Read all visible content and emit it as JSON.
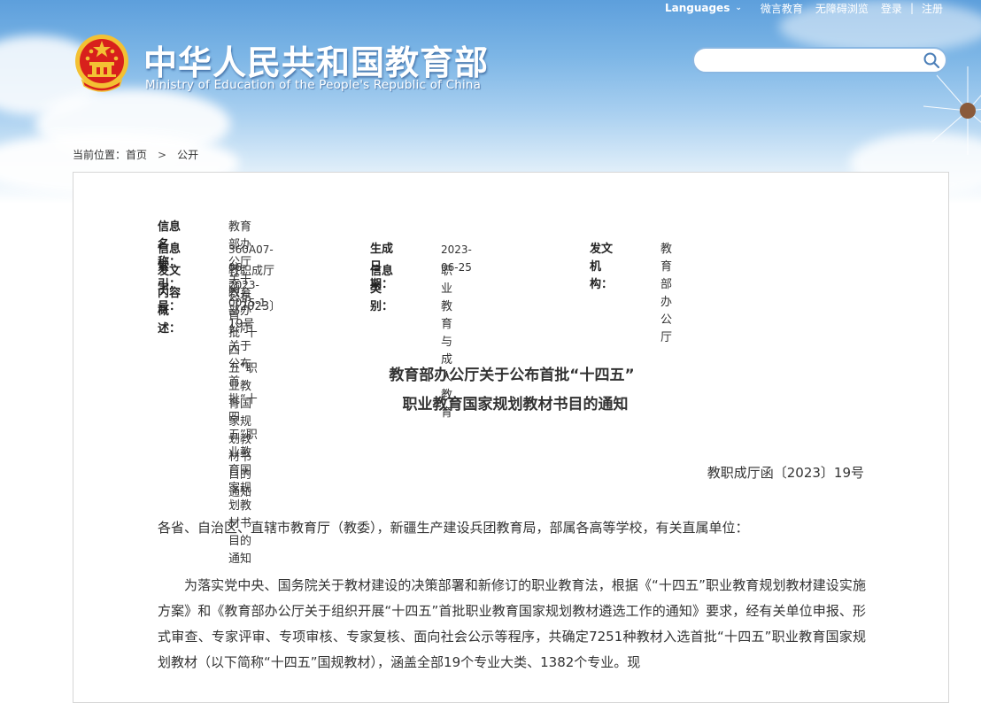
{
  "header": {
    "topbar": {
      "languages": "Languages",
      "weibo": "微言教育",
      "accessibility": "无障碍浏览",
      "login": "登录",
      "separator": "|",
      "register": "注册"
    },
    "title_cn": "中华人民共和国教育部",
    "title_en": "Ministry of Education of the People's Republic of China",
    "search_placeholder": ""
  },
  "breadcrumb": {
    "prefix": "当前位置：",
    "home": "首页",
    "arrow": ">",
    "current": "公开"
  },
  "meta": {
    "name_label": "信息名称：",
    "name_value": "教育部办公厅关于公布首批“十四五”职业教育国家规划教材书目的通知",
    "index_label": "信息索引：",
    "index_value": "360A07-06-2023-0015-1",
    "date_label": "生成日期：",
    "date_value": "2023-06-25",
    "org_label": "发文机构：",
    "org_value": "教育部办公厅",
    "docno_label": "发文字号：",
    "docno_value": "教职成厅函〔2023〕19号",
    "category_label": "信息类别：",
    "category_value": "职业教育与成人教育",
    "summary_label": "内容概述：",
    "summary_value": "教育部办公厅关于公布首批“十四五”职业教育国家规划教材书目的通知"
  },
  "document": {
    "title_line1": "教育部办公厅关于公布首批“十四五”",
    "title_line2": "职业教育国家规划教材书目的通知",
    "doc_number": "教职成厅函〔2023〕19号",
    "salutation": "各省、自治区、直辖市教育厅（教委），新疆生产建设兵团教育局，部属各高等学校，有关直属单位：",
    "paragraph1": "为落实党中央、国务院关于教材建设的决策部署和新修订的职业教育法，根据《“十四五”职业教育规划教材建设实施方案》和《教育部办公厅关于组织开展“十四五”首批职业教育国家规划教材遴选工作的通知》要求，经有关单位申报、形式审查、专家评审、专项审核、专家复核、面向社会公示等程序，共确定7251种教材入选首批“十四五”职业教育国家规划教材（以下简称“十四五”国规教材），涵盖全部19个专业大类、1382个专业。现"
  },
  "colors": {
    "sky_top": "#5d9fdc",
    "emblem_red": "#d8201c",
    "emblem_gold": "#f3c133",
    "text": "#333333",
    "panel_border": "#d6d6d6"
  }
}
